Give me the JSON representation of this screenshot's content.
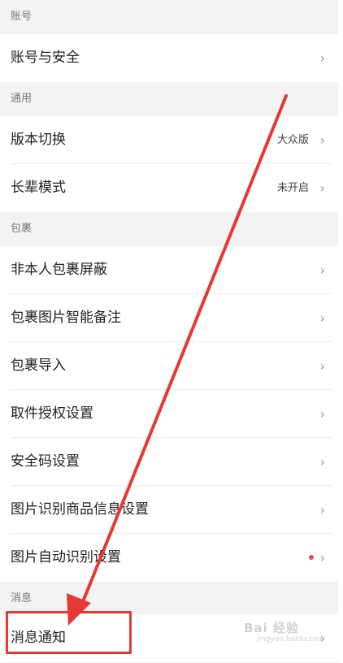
{
  "sections": [
    {
      "header": "账号",
      "items": [
        {
          "label": "账号与安全",
          "value": "",
          "dot": false
        }
      ]
    },
    {
      "header": "通用",
      "items": [
        {
          "label": "版本切换",
          "value": "大众版",
          "dot": false
        },
        {
          "label": "长辈模式",
          "value": "未开启",
          "dot": false
        }
      ]
    },
    {
      "header": "包裹",
      "items": [
        {
          "label": "非本人包裹屏蔽",
          "value": "",
          "dot": false
        },
        {
          "label": "包裹图片智能备注",
          "value": "",
          "dot": false
        },
        {
          "label": "包裹导入",
          "value": "",
          "dot": false
        },
        {
          "label": "取件授权设置",
          "value": "",
          "dot": false
        },
        {
          "label": "安全码设置",
          "value": "",
          "dot": false
        },
        {
          "label": "图片识别商品信息设置",
          "value": "",
          "dot": false
        },
        {
          "label": "图片自动识别设置",
          "value": "",
          "dot": true
        }
      ]
    },
    {
      "header": "消息",
      "items": [
        {
          "label": "消息通知",
          "value": "",
          "dot": false
        }
      ]
    }
  ],
  "chevron_glyph": "›",
  "annotation": {
    "color": "#e53935"
  },
  "watermark": {
    "text": "Bai 经验",
    "sub": "jingyan.baidu.com"
  }
}
